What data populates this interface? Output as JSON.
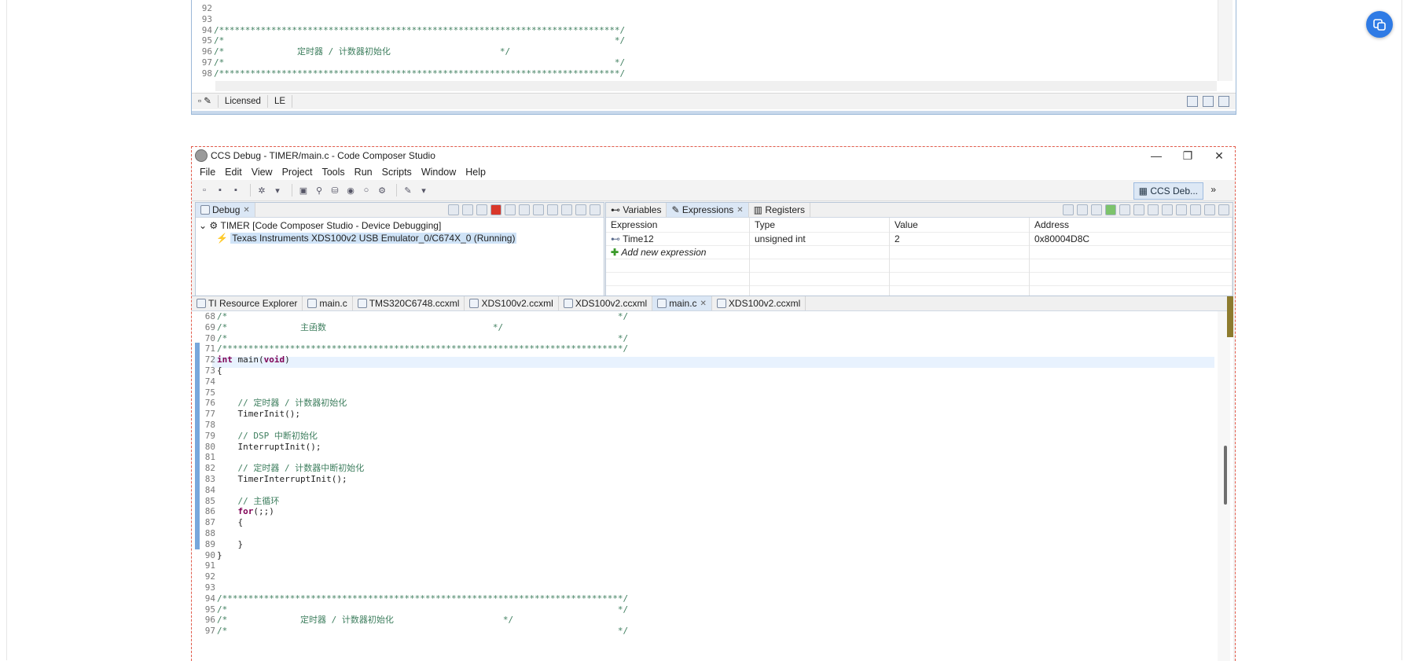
{
  "top_window": {
    "code_lines": [
      {
        "n": "92",
        "text": ""
      },
      {
        "n": "93",
        "text": ""
      },
      {
        "n": "94",
        "text": "/*****************************************************************************/"
      },
      {
        "n": "95",
        "text": "/*                                                                           */"
      },
      {
        "n": "96",
        "text": "/*              定时器 / 计数器初始化                     */"
      },
      {
        "n": "97",
        "text": "/*                                                                           */"
      },
      {
        "n": "98",
        "text": "/*****************************************************************************/"
      }
    ],
    "status": {
      "licensed": "Licensed",
      "le": "LE"
    }
  },
  "window": {
    "title": "CCS Debug - TIMER/main.c - Code Composer Studio",
    "controls": {
      "minimize": "—",
      "maximize": "❐",
      "close": "✕"
    }
  },
  "menu": [
    "File",
    "Edit",
    "View",
    "Project",
    "Tools",
    "Run",
    "Scripts",
    "Window",
    "Help"
  ],
  "perspective": {
    "label": "CCS Deb...",
    "more": "»"
  },
  "debug_view": {
    "tab": "Debug",
    "tree": [
      {
        "label": "TIMER [Code Composer Studio - Device Debugging]"
      },
      {
        "label": "Texas Instruments XDS100v2 USB Emulator_0/C674X_0 (Running)"
      }
    ]
  },
  "expressions_view": {
    "tabs": [
      "Variables",
      "Expressions",
      "Registers"
    ],
    "columns": [
      "Expression",
      "Type",
      "Value",
      "Address"
    ],
    "rows": [
      {
        "expression": "Time12",
        "type": "unsigned int",
        "value": "2",
        "address": "0x80004D8C"
      }
    ],
    "add_new": "Add new expression"
  },
  "editor": {
    "tabs": [
      "TI Resource Explorer",
      "main.c",
      "TMS320C6748.ccxml",
      "XDS100v2.ccxml",
      "XDS100v2.ccxml",
      "main.c",
      "XDS100v2.ccxml"
    ],
    "lines": [
      {
        "n": "68",
        "code": "/*                                                                           */"
      },
      {
        "n": "69",
        "code": "/*              主函数                                */"
      },
      {
        "n": "70",
        "code": "/*                                                                           */"
      },
      {
        "n": "71",
        "code": "/*****************************************************************************/"
      },
      {
        "n": "72",
        "code": "int main(void)"
      },
      {
        "n": "73",
        "code": "{"
      },
      {
        "n": "74",
        "code": ""
      },
      {
        "n": "75",
        "code": ""
      },
      {
        "n": "76",
        "code": "    // 定时器 / 计数器初始化"
      },
      {
        "n": "77",
        "code": "    TimerInit();"
      },
      {
        "n": "78",
        "code": ""
      },
      {
        "n": "79",
        "code": "    // DSP 中断初始化"
      },
      {
        "n": "80",
        "code": "    InterruptInit();"
      },
      {
        "n": "81",
        "code": ""
      },
      {
        "n": "82",
        "code": "    // 定时器 / 计数器中断初始化"
      },
      {
        "n": "83",
        "code": "    TimerInterruptInit();"
      },
      {
        "n": "84",
        "code": ""
      },
      {
        "n": "85",
        "code": "    // 主循环"
      },
      {
        "n": "86",
        "code": "    for(;;)"
      },
      {
        "n": "87",
        "code": "    {"
      },
      {
        "n": "88",
        "code": ""
      },
      {
        "n": "89",
        "code": "    }"
      },
      {
        "n": "90",
        "code": "}"
      },
      {
        "n": "91",
        "code": ""
      },
      {
        "n": "92",
        "code": ""
      },
      {
        "n": "93",
        "code": ""
      },
      {
        "n": "94",
        "code": "/*****************************************************************************/"
      },
      {
        "n": "95",
        "code": "/*                                                                           */"
      },
      {
        "n": "96",
        "code": "/*              定时器 / 计数器初始化                     */"
      },
      {
        "n": "97",
        "code": "/*                                                                           */"
      }
    ]
  },
  "colors": {
    "accent": "#2f7be5",
    "comment": "#3f7f5f",
    "keyword": "#7f0055",
    "selection": "#cfe3f7",
    "frame": "#e35b4b"
  }
}
